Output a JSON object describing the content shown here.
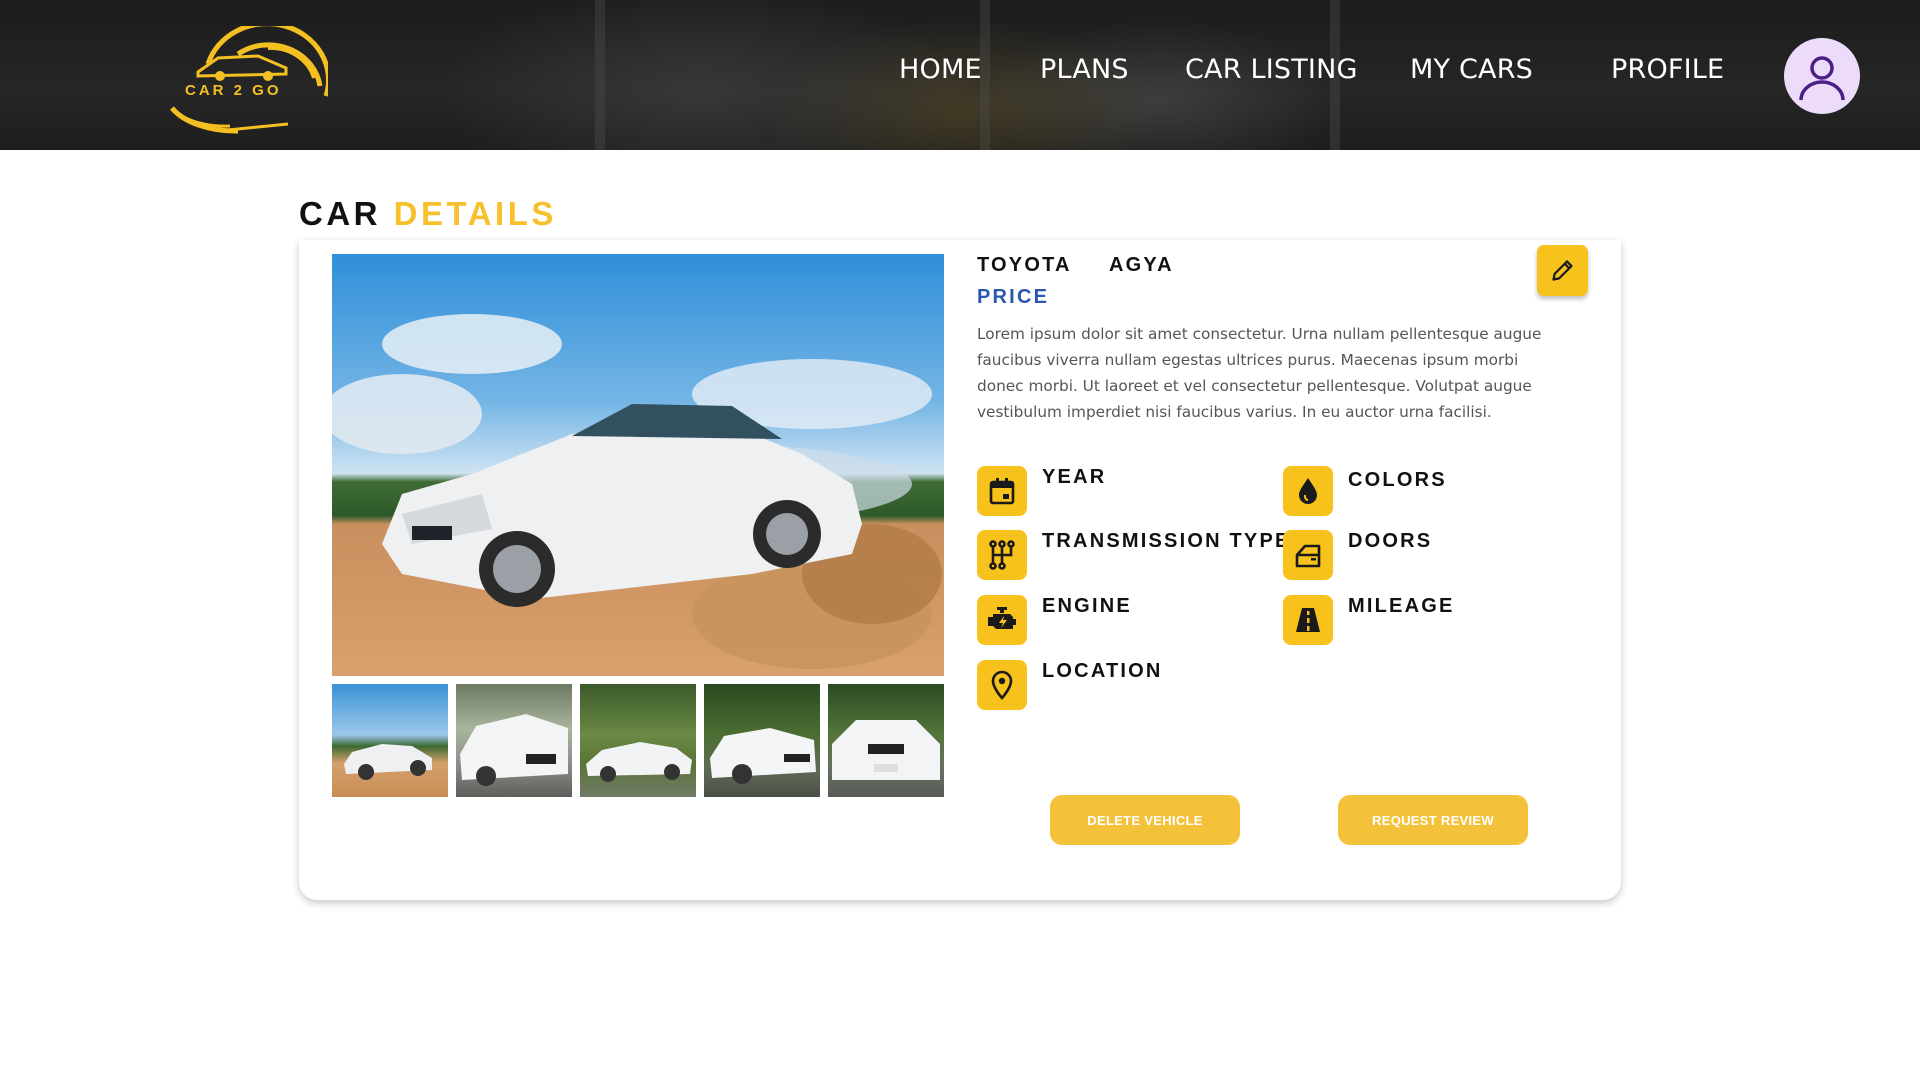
{
  "brand": {
    "logo_text": "CAR 2 GO",
    "accent": "#f4c021"
  },
  "nav": {
    "items": [
      {
        "label": "HOME"
      },
      {
        "label": "PLANS"
      },
      {
        "label": "CAR LISTING"
      },
      {
        "label": "MY CARS"
      },
      {
        "label": "PROFILE"
      }
    ],
    "avatar_icon": "user-icon"
  },
  "page": {
    "title_part1": "CAR",
    "title_part2": "DETAILS"
  },
  "car": {
    "make": "TOYOTA",
    "model": "AGYA",
    "price_label": "PRICE",
    "description": "Lorem ipsum dolor sit amet consectetur. Urna nullam pellentesque augue faucibus viverra nullam egestas ultrices purus. Maecenas ipsum morbi donec morbi. Ut laoreet et vel consectetur pellentesque. Volutpat augue vestibulum imperdiet nisi faucibus varius. In eu auctor urna facilisi."
  },
  "specs": [
    {
      "label": "YEAR",
      "icon": "calendar-icon"
    },
    {
      "label": "COLORS",
      "icon": "drop-icon"
    },
    {
      "label": "TRANSMISSION TYPE",
      "icon": "gearshift-icon"
    },
    {
      "label": "DOORS",
      "icon": "car-door-icon"
    },
    {
      "label": "ENGINE",
      "icon": "engine-icon"
    },
    {
      "label": "MILEAGE",
      "icon": "road-icon"
    },
    {
      "label": "LOCATION",
      "icon": "map-pin-icon"
    }
  ],
  "actions": {
    "delete_label": "DELETE VEHICLE",
    "review_label": "REQUEST REVIEW",
    "edit_icon": "pencil-icon"
  },
  "colors": {
    "accent_yellow": "#f7c21b",
    "price_blue": "#2b57b0",
    "button_yellow": "#f4c13b"
  }
}
